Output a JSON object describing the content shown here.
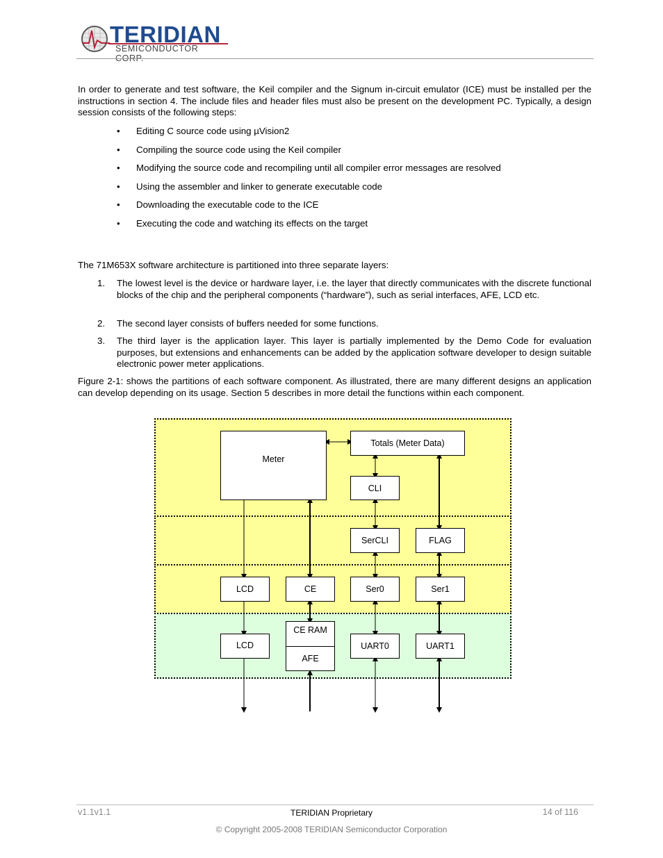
{
  "header": {
    "logo_word": "TERIDIAN",
    "logo_sub": "SEMICONDUCTOR CORP."
  },
  "intro_paragraph": "In order to generate and test software, the Keil compiler and the Signum in-circuit emulator (ICE) must be installed per the instructions in section 4. The include files and header files must also be present on the development PC. Typically, a design session consists of the following steps:",
  "steps": [
    "Editing C source code using µVision2",
    "Compiling the source code using the Keil compiler",
    "Modifying the source code and recompiling until all compiler error messages are resolved",
    "Using the assembler and linker to generate executable code",
    "Downloading the executable code to the ICE",
    "Executing the code and watching its effects on the target"
  ],
  "bullet_glyph": "•",
  "architecture_intro": "The 71M653X software architecture is partitioned into three separate layers:",
  "layers_list": [
    {
      "num": "1.",
      "text": "The lowest level is the device or hardware layer, i.e. the layer that directly communicates with the discrete functional blocks of the chip and the peripheral components (“hardware”), such as serial interfaces, AFE, LCD etc."
    },
    {
      "num": "2.",
      "text": "The second layer consists of buffers needed for some functions."
    },
    {
      "num": "3.",
      "text": "The third layer is the application layer. This layer is partially implemented by the Demo Code for evaluation purposes, but extensions and enhancements can be added by the application software developer to design suitable electronic power meter applications."
    }
  ],
  "figure_paragraph": "Figure 2-1: shows the partitions of each software component. As illustrated, there are many different designs an application can develop depending on its usage. Section 5 describes in more detail the functions within each component.",
  "diagram": {
    "colors": {
      "application_layer": "#ffff99",
      "hardware_layer": "#ddffdd"
    },
    "blocks": {
      "meter": "Meter",
      "totals": "Totals (Meter Data)",
      "cli": "CLI",
      "sercli": "SerCLI",
      "flag": "FLAG",
      "lcd_driver": "LCD",
      "ce": "CE",
      "ser0": "Ser0",
      "ser1": "Ser1",
      "lcd_hw": "LCD",
      "ce_ram": "CE RAM",
      "afe": "AFE",
      "uart0": "UART0",
      "uart1": "UART1"
    }
  },
  "footer": {
    "version": "v1.1v1.1",
    "proprietary": "TERIDIAN Proprietary",
    "page": "14 of 116",
    "copyright": "© Copyright 2005-2008 TERIDIAN Semiconductor Corporation"
  }
}
